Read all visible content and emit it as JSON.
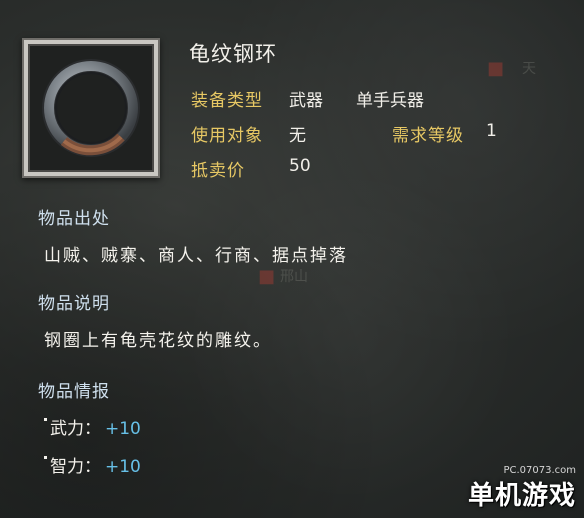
{
  "item": {
    "name": "龟纹钢环",
    "icon": "steel-ring-icon"
  },
  "attributes": {
    "equip_type_label": "装备类型",
    "equip_type_value1": "武器",
    "equip_type_value2": "单手兵器",
    "target_label": "使用对象",
    "target_value": "无",
    "level_label": "需求等级",
    "level_value": "1",
    "price_label": "抵卖价",
    "price_value": "50"
  },
  "source": {
    "heading": "物品出处",
    "text": "山贼、贼寨、商人、行商、据点掉落"
  },
  "description": {
    "heading": "物品说明",
    "text": "钢圈上有龟壳花纹的雕纹。"
  },
  "info": {
    "heading": "物品情报",
    "stats": [
      {
        "label": "武力：",
        "value": "+10"
      },
      {
        "label": "智力：",
        "value": "+10"
      }
    ]
  },
  "background": {
    "mark1": "天",
    "map_label": "邢山"
  },
  "watermark": {
    "url": "PC.07073.com",
    "logo": "单机游戏"
  },
  "colors": {
    "label_gold": "#e7c864",
    "stat_blue": "#67c0e7"
  }
}
